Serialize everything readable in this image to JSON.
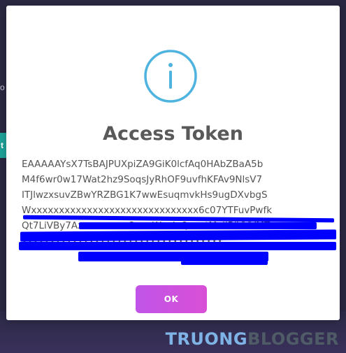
{
  "background": {
    "left_text_fragment": "o",
    "left_button_fragment": "t"
  },
  "modal": {
    "icon": "info-circle-icon",
    "icon_color": "#4fb3e0",
    "title": "Access Token",
    "token_lines": [
      "EAAAAAYsX7TsBAJPUXpiZA9GiK0lcfAq0HAbZBaA5b",
      "M4f6wr0w17Wat2hz9SoqsJyRhOF9uvfhKFAv9NlsV7",
      "ITJlwzxsuvZBwYRZBG1K7wwEsuqmvkHs9ugDXvbgS",
      "Wxxxxxxxxxxxxxxxxxxxxxxxxxxxxxx6c07YTFuvPwfk",
      "Qt7LiVBy7AxxxxxxxxxOxxxWxxlxQxxxtMxilBlVVVMT",
      "xxxxxxxxxxxxxxxxxxxxxxxxxxxxxxxxxxxx"
    ],
    "ok_label": "OK",
    "ok_gradient": [
      "#c054e8",
      "#d94fd6"
    ]
  },
  "watermark": {
    "part1": "TRUONG",
    "part2": "BLOGGER"
  }
}
